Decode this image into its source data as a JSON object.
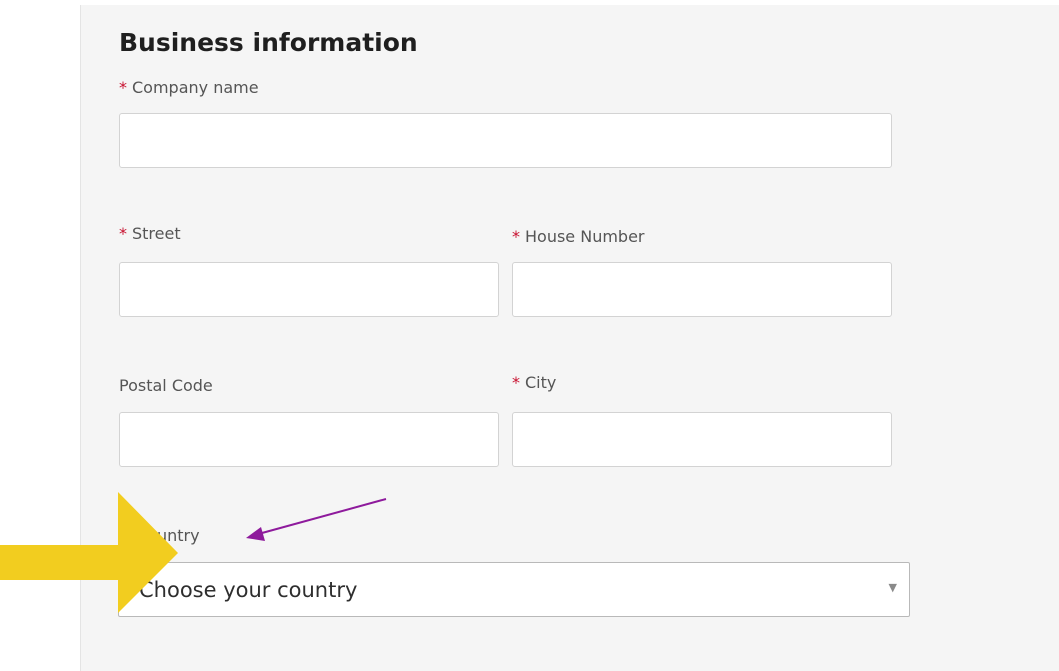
{
  "section": {
    "title": "Business information"
  },
  "form": {
    "required_marker": "*",
    "company_name": {
      "label": "Company name",
      "value": ""
    },
    "street": {
      "label": "Street",
      "value": ""
    },
    "house_number": {
      "label": "House Number",
      "value": ""
    },
    "postal_code": {
      "label": "Postal Code",
      "value": ""
    },
    "city": {
      "label": "City",
      "value": ""
    },
    "country": {
      "label": "Country",
      "selected": "Choose your country"
    }
  },
  "annotations": {
    "yellow_arrow_color": "#f2cd1f",
    "purple_arrow_color": "#8e1a9c"
  },
  "icons": {
    "dropdown": "caret-down-icon"
  }
}
